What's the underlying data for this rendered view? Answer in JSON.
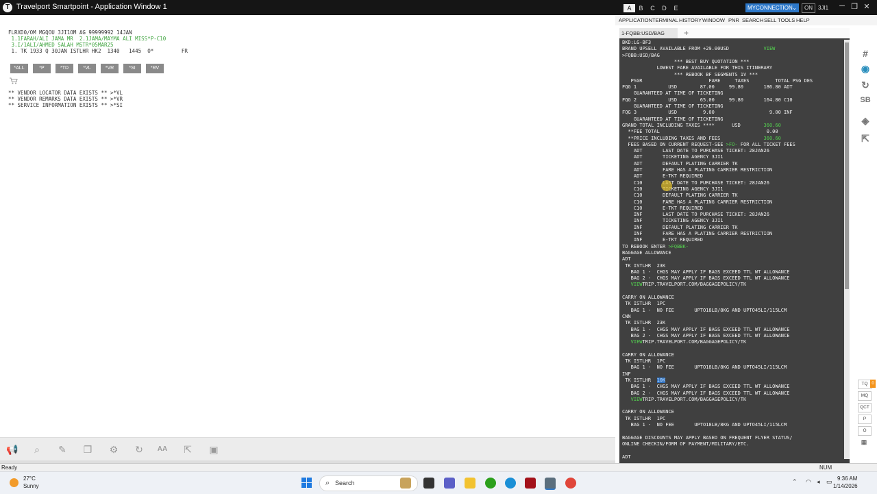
{
  "window": {
    "title": "Travelport Smartpoint - Application Window 1",
    "tabs": [
      "A",
      "B",
      "C",
      "D",
      "E"
    ],
    "active_tab": "A",
    "connection": "MYCONNECTION",
    "connection_state": "ON",
    "pcc": "3JI1"
  },
  "pnr_display": {
    "lines": [
      "FLRXD0/OM MGQOU 3JI1OM AG 99999992 14JAN",
      " 1.1FARAH/ALI JAMA MR  2.1JAMA/MAYMA ALI MISS*P-C10",
      " 3.I/1ALI/AHMED SALAH MSTR*05MAR25",
      " 1. TK 1933 Q 30JAN ISTLHR HK2  1340   1445  O*         FR"
    ],
    "quick_buttons": [
      "*ALL",
      "*P",
      "*TD",
      "*VL",
      "*VR",
      "*SI",
      "*RV"
    ],
    "info_lines": [
      "** VENDOR LOCATOR DATA EXISTS ** >*VL",
      "** VENDOR REMARKS DATA EXISTS ** >*VR",
      "** SERVICE INFORMATION EXISTS ** >*SI"
    ]
  },
  "toolbar_icons": [
    "megaphone-icon",
    "search-icon",
    "pencil-icon",
    "copy-icon",
    "gear-icon",
    "refresh-icon",
    "text-size-icon",
    "external-link-icon",
    "image-icon"
  ],
  "menu": [
    "APPLICATION",
    "TERMINAL",
    "HISTORY",
    "WINDOW",
    "PNR",
    "SEARCH",
    "SELL",
    "TOOLS",
    "HELP"
  ],
  "terminal_tab": "1-FQBB:USD/BAG",
  "terminal_lines": [
    "BKD:LG-BF3",
    "BRAND UPSELL AVAILABLE FROM +29.00USD            VIEW",
    ">FQBB:USD/BAG",
    "                  *** BEST BUY QUOTATION ***",
    "            LOWEST FARE AVAILABLE FOR THIS ITINERARY",
    "                  *** REBOOK BF SEGMENTS 1V ***",
    "   PSGR                       FARE     TAXES         TOTAL PSG DES",
    "FQG 1           USD        87.00     99.80       186.80 ADT",
    "    GUARANTEED AT TIME OF TICKETING",
    "FQG 2           USD        65.00     99.80       164.80 C10",
    "    GUARANTEED AT TIME OF TICKETING",
    "FQG 3           USD         9.00                   9.00 INF",
    "    GUARANTEED AT TIME OF TICKETING",
    "GRAND TOTAL INCLUDING TAXES ****      USD        360.60",
    "  **FEE TOTAL                                     0.00",
    "  **PRICE INCLUDING TAXES AND FEES               360.60",
    "  FEES BASED ON CURRENT REQUEST-SEE >FO- FOR ALL TICKET FEES",
    "    ADT       LAST DATE TO PURCHASE TICKET: 28JAN26",
    "    ADT       TICKETING AGENCY 3JI1",
    "    ADT       DEFAULT PLATING CARRIER TK",
    "    ADT       FARE HAS A PLATING CARRIER RESTRICTION",
    "    ADT       E-TKT REQUIRED",
    "    C10       LAST DATE TO PURCHASE TICKET: 28JAN26",
    "    C10       TICKETING AGENCY 3JI1",
    "    C10       DEFAULT PLATING CARRIER TK",
    "    C10       FARE HAS A PLATING CARRIER RESTRICTION",
    "    C10       E-TKT REQUIRED",
    "    INF       LAST DATE TO PURCHASE TICKET: 28JAN26",
    "    INF       TICKETING AGENCY 3JI1",
    "    INF       DEFAULT PLATING CARRIER TK",
    "    INF       FARE HAS A PLATING CARRIER RESTRICTION",
    "    INF       E-TKT REQUIRED",
    "TO REBOOK ENTER >FQBBK-",
    "BAGGAGE ALLOWANCE",
    "ADT",
    " TK ISTLHR  23K",
    "   BAG 1 -  CHGS MAY APPLY IF BAGS EXCEED TTL WT ALLOWANCE",
    "   BAG 2 -  CHGS MAY APPLY IF BAGS EXCEED TTL WT ALLOWANCE",
    "   VIEWTRIP.TRAVELPORT.COM/BAGGAGEPOLICY/TK",
    "",
    "CARRY ON ALLOWANCE",
    " TK ISTLHR  1PC",
    "   BAG 1 -  NO FEE       UPTO18LB/8KG AND UPTO45LI/115LCM",
    "CNN",
    " TK ISTLHR  23K",
    "   BAG 1 -  CHGS MAY APPLY IF BAGS EXCEED TTL WT ALLOWANCE",
    "   BAG 2 -  CHGS MAY APPLY IF BAGS EXCEED TTL WT ALLOWANCE",
    "   VIEWTRIP.TRAVELPORT.COM/BAGGAGEPOLICY/TK",
    "",
    "CARRY ON ALLOWANCE",
    " TK ISTLHR  1PC",
    "   BAG 1 -  NO FEE       UPTO18LB/8KG AND UPTO45LI/115LCM",
    "INF",
    " TK ISTLHR  10K",
    "   BAG 1 -  CHGS MAY APPLY IF BAGS EXCEED TTL WT ALLOWANCE",
    "   BAG 2 -  CHGS MAY APPLY IF BAGS EXCEED TTL WT ALLOWANCE",
    "   VIEWTRIP.TRAVELPORT.COM/BAGGAGEPOLICY/TK",
    "",
    "CARRY ON ALLOWANCE",
    " TK ISTLHR  1PC",
    "   BAG 1 -  NO FEE       UPTO18LB/8KG AND UPTO45LI/115LCM",
    "",
    "BAGGAGE DISCOUNTS MAY APPLY BASED ON FREQUENT FLYER STATUS/",
    "ONLINE CHECKIN/FORM OF PAYMENT/MILITARY/ETC.",
    "",
    "ADT"
  ],
  "side_icons": [
    "hash-icon",
    "globe-icon",
    "sync-icon",
    "sb-icon",
    "tag-icon",
    "external-link-icon"
  ],
  "side_pills": [
    "TQ",
    "MQ",
    "QCT",
    "P",
    "O"
  ],
  "tq_badge": "0",
  "status": {
    "ready": "Ready",
    "num": "NUM"
  },
  "taskbar": {
    "weather_temp": "27°C",
    "weather_cond": "Sunny",
    "search": "Search",
    "time": "9:36 AM",
    "date": "1/14/2026"
  },
  "colors": {
    "terminal_bg": "#404040",
    "terminal_text": "#f2f2f2",
    "terminal_green": "#54d34f",
    "accent": "#2d78c9"
  }
}
